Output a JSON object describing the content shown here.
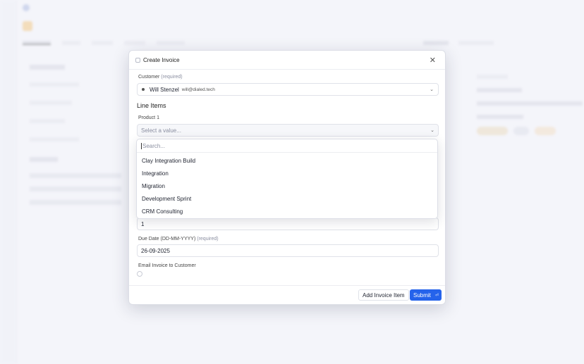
{
  "modal": {
    "title": "Create Invoice",
    "customer": {
      "label": "Customer",
      "required": "(required)",
      "name": "Will Stenzel",
      "email": "will@dialed.tech"
    },
    "line_items_title": "Line Items",
    "product": {
      "label": "Product 1",
      "placeholder": "Select a value..."
    },
    "quantity_value": "1",
    "due_date": {
      "label": "Due Date (DD-MM-YYYY)",
      "required": "(required)",
      "value": "26-09-2025"
    },
    "email_invoice_label": "Email Invoice to Customer",
    "add_item_label": "Add Invoice Item",
    "submit_label": "Submit",
    "submit_shortcut": "⏎"
  },
  "dropdown": {
    "search_placeholder": "Search...",
    "options": [
      "Clay Integration Build",
      "Integration",
      "Migration",
      "Development Sprint",
      "CRM Consulting"
    ]
  },
  "icons": {
    "close": "close-icon",
    "chevron": "chevron-down-icon"
  },
  "colors": {
    "accent": "#2563eb",
    "background": "#f3f4f9"
  }
}
